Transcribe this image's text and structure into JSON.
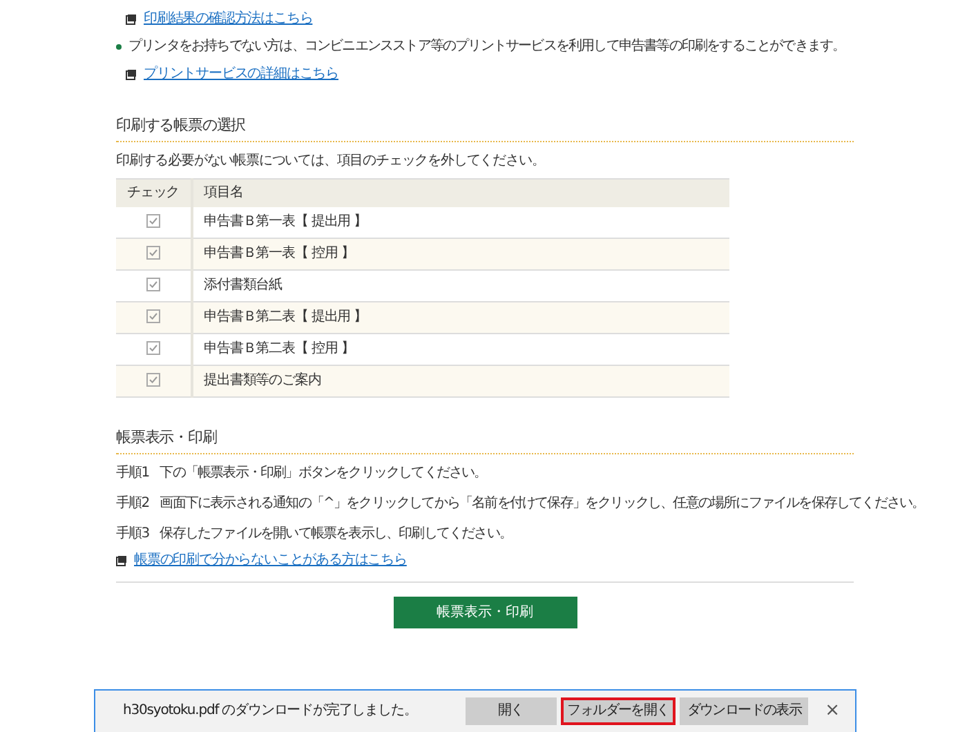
{
  "top_links": [
    {
      "kind": "link",
      "text": "印刷結果の確認方法はこちら"
    },
    {
      "kind": "bullet",
      "text": "プリンタをお持ちでない方は、コンビニエンスストア等のプリントサービスを利用して申告書等の印刷をすることができます。"
    },
    {
      "kind": "link",
      "text": "プリントサービスの詳細はこちら"
    }
  ],
  "selection": {
    "heading": "印刷する帳票の選択",
    "note": "印刷する必要がない帳票については、項目のチェックを外してください。",
    "table": {
      "columns": [
        "チェック",
        "項目名"
      ],
      "rows": [
        {
          "checked": true,
          "name": "申告書Ｂ第一表【 提出用 】"
        },
        {
          "checked": true,
          "name": "申告書Ｂ第一表【 控用 】"
        },
        {
          "checked": true,
          "name": "添付書類台紙"
        },
        {
          "checked": true,
          "name": "申告書Ｂ第二表【 提出用 】"
        },
        {
          "checked": true,
          "name": "申告書Ｂ第二表【 控用 】"
        },
        {
          "checked": true,
          "name": "提出書類等のご案内"
        }
      ]
    }
  },
  "print": {
    "heading": "帳票表示・印刷",
    "steps": [
      {
        "label": "手順1",
        "text": "下の「帳票表示・印刷」ボタンをクリックしてください。"
      },
      {
        "label": "手順2",
        "text": "画面下に表示される通知の「^」をクリックしてから「名前を付けて保存」をクリックし、任意の場所にファイルを保存してください。"
      },
      {
        "label": "手順3",
        "text": "保存したファイルを開いて帳票を表示し、印刷してください。"
      }
    ],
    "help_link": "帳票の印刷で分からないことがある方はこちら",
    "button": "帳票表示・印刷"
  },
  "download_bar": {
    "message": "h30syotoku.pdf のダウンロードが完了しました。",
    "buttons": [
      {
        "label": "開く",
        "selected": false
      },
      {
        "label": "フォルダーを開く",
        "selected": true
      },
      {
        "label": "ダウンロードの表示",
        "selected": false
      }
    ],
    "close": "×"
  }
}
